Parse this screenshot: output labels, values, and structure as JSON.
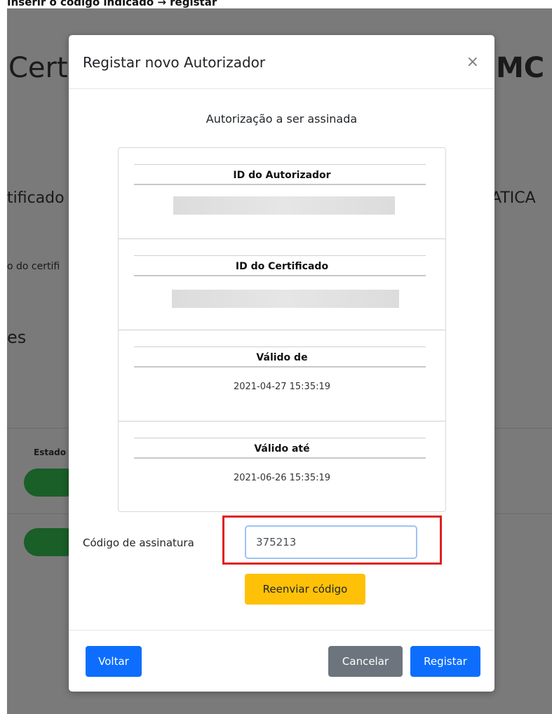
{
  "caption": "Inserir o código indicado → registar",
  "background": {
    "title_left": "Cert",
    "title_right": "MC",
    "sub_left": "tificado",
    "sub_right": "ATICA",
    "small": "o do certifi",
    "es": "es",
    "estado": "Estado"
  },
  "modal": {
    "title": "Registar novo Autorizador",
    "close_symbol": "×",
    "subtitle": "Autorização a ser assinada",
    "sections": [
      {
        "label": "ID do Autorizador",
        "value": ""
      },
      {
        "label": "ID do Certificado",
        "value": ""
      },
      {
        "label": "Válido de",
        "value": "2021-04-27 15:35:19"
      },
      {
        "label": "Válido até",
        "value": "2021-06-26 15:35:19"
      }
    ],
    "signature": {
      "label": "Código de assinatura",
      "value": "375213"
    },
    "resend_label": "Reenviar código",
    "footer": {
      "back_label": "Voltar",
      "cancel_label": "Cancelar",
      "register_label": "Registar"
    }
  },
  "colors": {
    "primary": "#0d6efd",
    "secondary": "#6c757d",
    "warning": "#ffc107",
    "highlight": "#e0201c"
  }
}
